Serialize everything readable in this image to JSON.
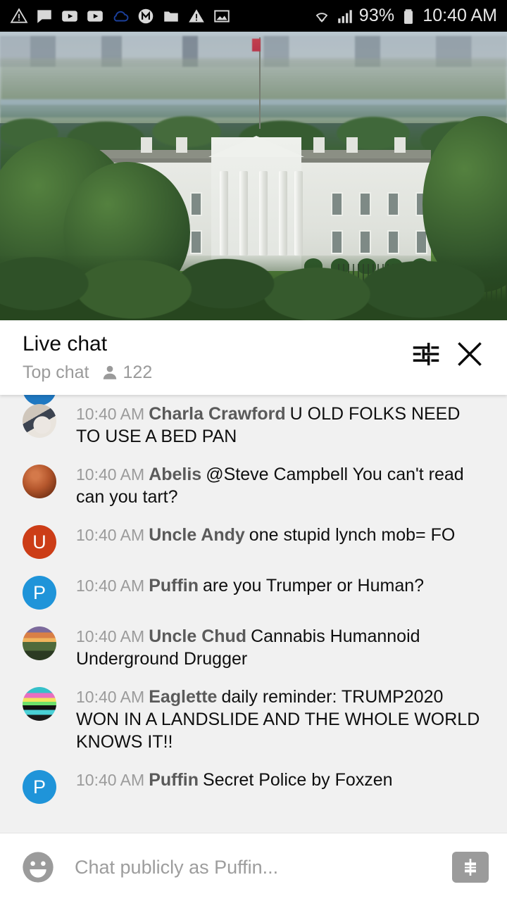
{
  "status_bar": {
    "icons": [
      "warning-triangle-icon",
      "chat-bubble-icon",
      "youtube-icon",
      "youtube-icon",
      "cloud-icon",
      "m-badge-icon",
      "folder-icon",
      "alert-triangle-icon",
      "image-icon"
    ],
    "wifi_icon": "wifi-icon",
    "signal_icon": "cellular-signal-icon",
    "battery_percent": "93%",
    "battery_icon": "battery-icon",
    "clock": "10:40 AM",
    "background": "#000000",
    "text_color": "#e8e8e8"
  },
  "video": {
    "name": "white-house-live-stream",
    "progress_color": "#fe0000",
    "progress_percent": 100
  },
  "chat_header": {
    "title": "Live chat",
    "subtitle": "Top chat",
    "viewer_icon": "person-icon",
    "viewer_count": "122",
    "settings_icon": "tune-settings-icon",
    "close_icon": "close-icon"
  },
  "messages": [
    {
      "avatar_type": "wedding",
      "avatar_name": "avatar-charla-crawford",
      "timestamp": "10:40 AM",
      "author": "Charla Crawford",
      "text": "U OLD FOLKS NEED TO USE A BED PAN"
    },
    {
      "avatar_type": "planet",
      "avatar_name": "avatar-abelis",
      "timestamp": "10:40 AM",
      "author": "Abelis",
      "text": "@Steve Campbell You can't read can you tart?"
    },
    {
      "avatar_type": "letter",
      "avatar_letter": "U",
      "avatar_color": "#cc3d17",
      "avatar_name": "avatar-uncle-andy",
      "timestamp": "10:40 AM",
      "author": "Uncle Andy",
      "text": "one stupid lynch mob= FO"
    },
    {
      "avatar_type": "letter",
      "avatar_letter": "P",
      "avatar_color": "#1f94d9",
      "avatar_name": "avatar-puffin",
      "timestamp": "10:40 AM",
      "author": "Puffin",
      "text": "are you Trumper or Human?"
    },
    {
      "avatar_type": "sunset",
      "avatar_name": "avatar-uncle-chud",
      "timestamp": "10:40 AM",
      "author": "Uncle Chud",
      "text": "Cannabis Humannoid Underground Drugger"
    },
    {
      "avatar_type": "rainbow",
      "avatar_name": "avatar-eaglette",
      "timestamp": "10:40 AM",
      "author": "Eaglette",
      "text": "daily reminder: TRUMP2020 WON IN A LANDSLIDE AND THE WHOLE WORLD KNOWS IT!!"
    },
    {
      "avatar_type": "letter",
      "avatar_letter": "P",
      "avatar_color": "#1f94d9",
      "avatar_name": "avatar-puffin",
      "timestamp": "10:40 AM",
      "author": "Puffin",
      "text": "Secret Police by Foxzen"
    }
  ],
  "input_bar": {
    "emoji_icon": "emoji-smiley-icon",
    "placeholder": "Chat publicly as Puffin...",
    "value": "",
    "superchat_icon": "super-chat-dollar-icon"
  }
}
